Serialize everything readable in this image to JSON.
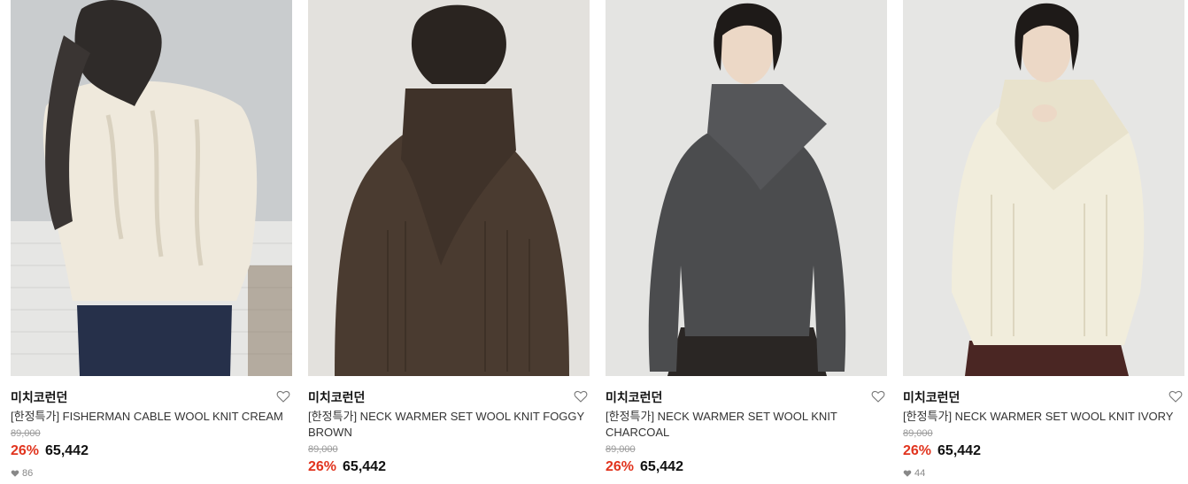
{
  "products": [
    {
      "brand": "미치코런던",
      "title": "[한정특가] FISHERMAN CABLE WOOL KNIT CREAM",
      "original_price": "89,000",
      "discount": "26%",
      "price": "65,442",
      "likes": "86",
      "colors": {
        "sweater": "#efe9dc",
        "background": "#c9ccce",
        "pants": "#26304a"
      }
    },
    {
      "brand": "미치코런던",
      "title": "[한정특가] NECK WARMER SET WOOL KNIT FOGGY BROWN",
      "original_price": "89,000",
      "discount": "26%",
      "price": "65,442",
      "colors": {
        "sweater": "#4a3b30",
        "background": "#e3e1dd"
      }
    },
    {
      "brand": "미치코런던",
      "title": "[한정특가] NECK WARMER SET WOOL KNIT CHARCOAL",
      "original_price": "89,000",
      "discount": "26%",
      "price": "65,442",
      "colors": {
        "sweater": "#4b4c4e",
        "background": "#e4e4e2",
        "skirt": "#2a2624"
      }
    },
    {
      "brand": "미치코런던",
      "title": "[한정특가] NECK WARMER SET WOOL KNIT IVORY",
      "original_price": "89,000",
      "discount": "26%",
      "price": "65,442",
      "likes": "44",
      "colors": {
        "sweater": "#f1eddc",
        "background": "#e6e6e4",
        "skirt": "#4a2623"
      }
    }
  ],
  "icons": {
    "wishlist": "heart-outline-icon",
    "like_count": "heart-filled-icon"
  }
}
